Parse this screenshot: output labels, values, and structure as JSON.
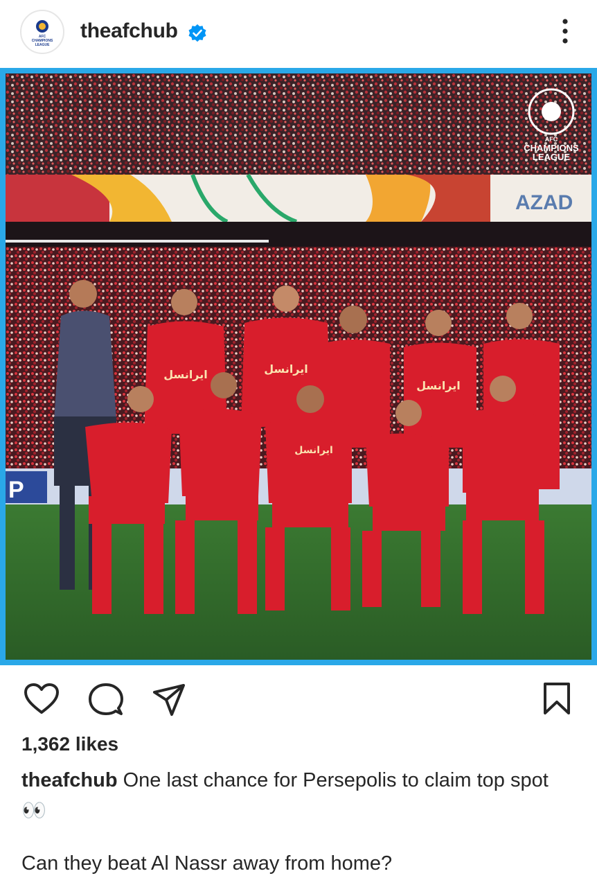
{
  "post": {
    "username": "theafchub",
    "verified": true,
    "avatar_logo_text": [
      "AFC",
      "CHAMPIONS",
      "LEAGUE"
    ],
    "more_icon": "more-vertical-icon"
  },
  "photo": {
    "watermark_lines": [
      "AFC",
      "CHAMPIONS",
      "LEAGUE"
    ],
    "banner_text": "AZAD",
    "board_text": "P",
    "sponsor_text": "ایرانسل"
  },
  "actions": {
    "like_icon": "heart-icon",
    "comment_icon": "comment-icon",
    "share_icon": "send-icon",
    "save_icon": "bookmark-icon"
  },
  "likes": "1,362 likes",
  "caption": {
    "username": "theafchub",
    "text": "One last chance for Persepolis to claim top spot 👀",
    "question": "Can they beat Al Nassr away from home?"
  },
  "colors": {
    "verified_blue": "#0095f6",
    "frame_blue": "#2aa8e8",
    "kit_red": "#d81e2c",
    "grass": "#2f6a2a"
  }
}
